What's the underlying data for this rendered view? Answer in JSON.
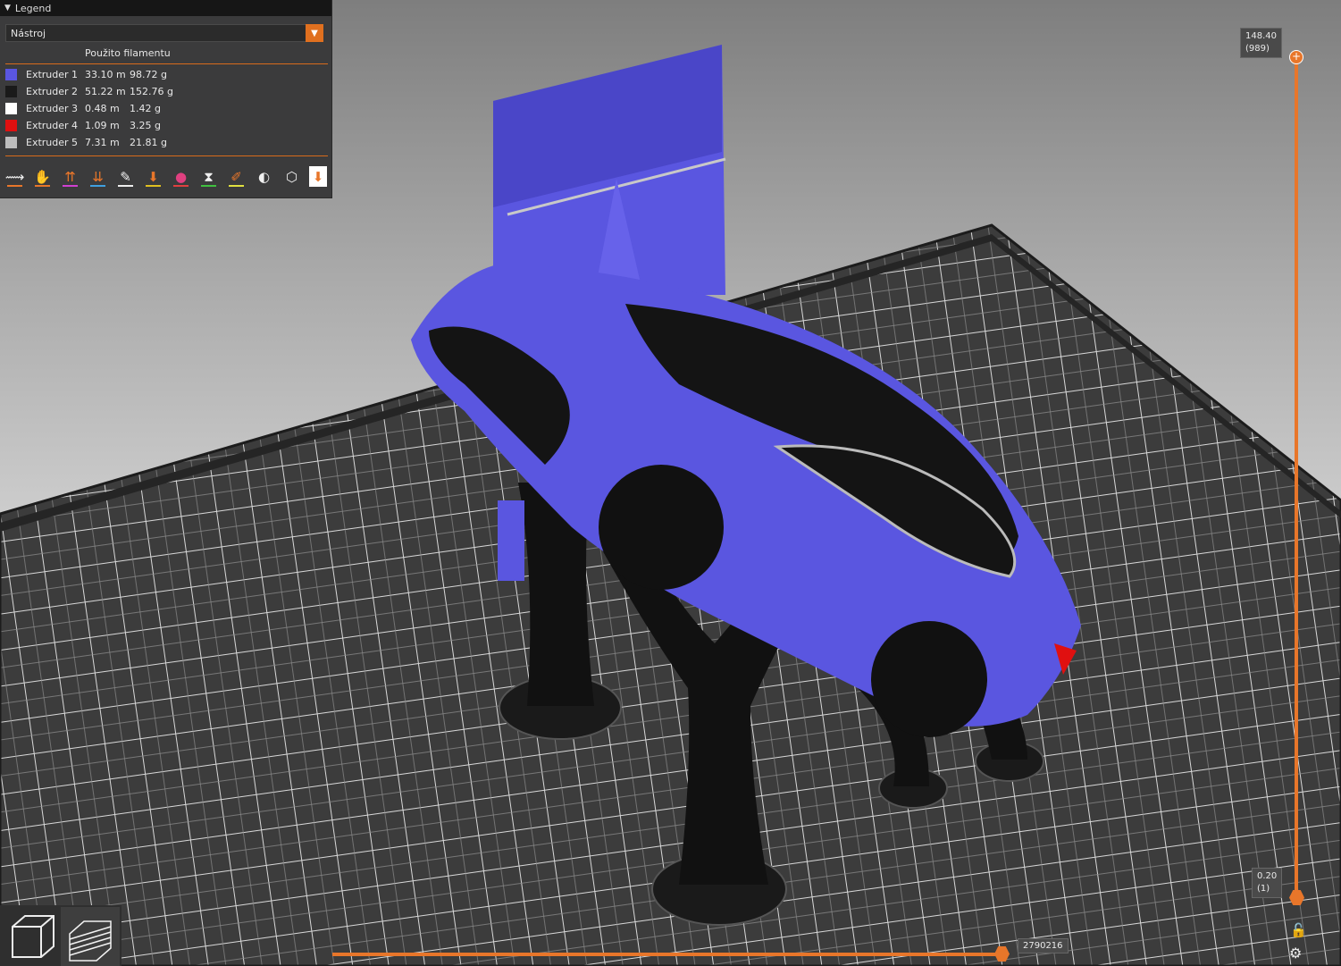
{
  "legend": {
    "title": "Legend",
    "tool_select": "Nástroj",
    "filament_heading": "Použito filamentu",
    "extruders": [
      {
        "name": "Extruder 1",
        "length": "33.10 m",
        "weight": "98.72 g",
        "color": "#5a56e0"
      },
      {
        "name": "Extruder 2",
        "length": "51.22 m",
        "weight": "152.76 g",
        "color": "#1a1a1a"
      },
      {
        "name": "Extruder 3",
        "length": "0.48 m",
        "weight": "1.42 g",
        "color": "#ffffff"
      },
      {
        "name": "Extruder 4",
        "length": "1.09 m",
        "weight": "3.25 g",
        "color": "#e01010"
      },
      {
        "name": "Extruder 5",
        "length": "7.31 m",
        "weight": "21.81 g",
        "color": "#bdbdbd"
      }
    ],
    "toolbar_icons": [
      "travel-icon",
      "wipe-icon",
      "retractions-icon",
      "deretractions-icon",
      "seams-icon",
      "tool-changes-icon",
      "color-changes-icon",
      "pause-prints-icon",
      "custom-gcode-icon",
      "center-of-gravity-icon",
      "shells-icon",
      "tool-marker-icon"
    ]
  },
  "vertical_slider": {
    "top_value": "148.40",
    "top_layer": "(989)",
    "bottom_value": "0.20",
    "bottom_layer": "(1)"
  },
  "horizontal_slider": {
    "value": "2790216",
    "fraction": 0.99
  },
  "colors": {
    "accent": "#e8762a",
    "model_primary": "#5a56e0",
    "model_secondary": "#1a1a1a",
    "bed": "#3a3a3a"
  }
}
